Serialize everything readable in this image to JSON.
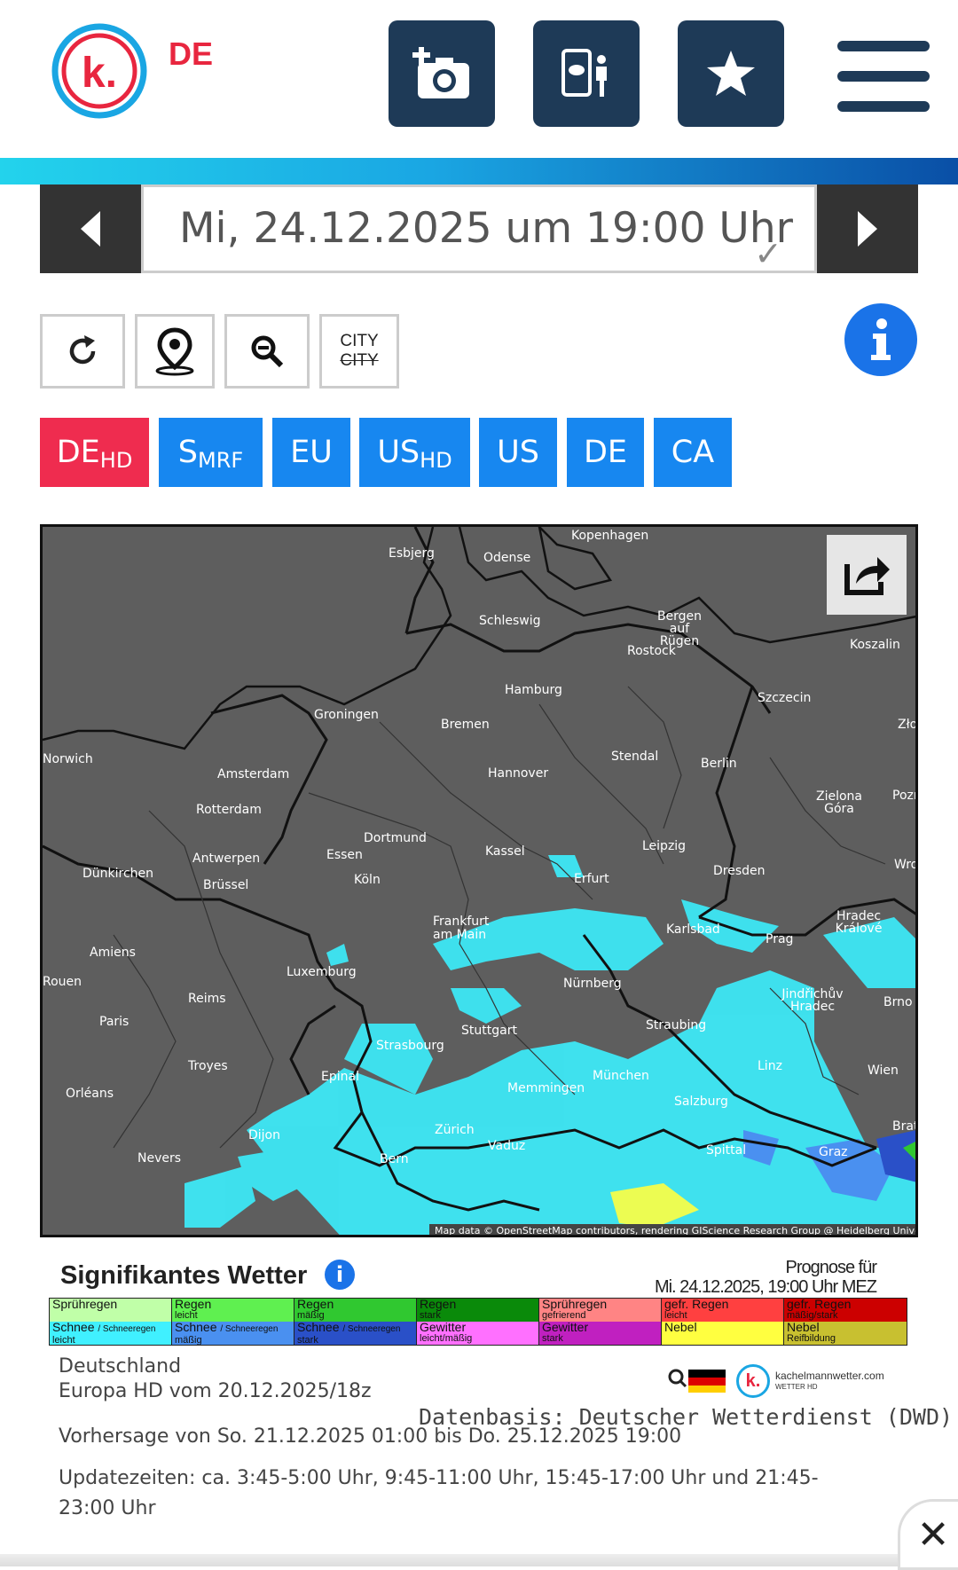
{
  "header": {
    "logo_letter": "k.",
    "region_label": "DE",
    "buttons": [
      {
        "name": "add-photo",
        "icon": "camera-plus-icon"
      },
      {
        "name": "weather-reporter",
        "icon": "phone-person-icon"
      },
      {
        "name": "favorites",
        "icon": "star-icon"
      }
    ],
    "menu_icon": "hamburger-icon"
  },
  "date_nav": {
    "selected": "Mi, 24.12.2025 um 19:00 Uhr",
    "check": "✓"
  },
  "tools": {
    "refresh_icon": "refresh-icon",
    "location_icon": "map-pin-icon",
    "zoom_icon": "zoom-out-icon",
    "city_on": "CITY",
    "city_off": "CITY"
  },
  "model_tabs": [
    {
      "main": "DE",
      "sub": "HD",
      "active": true
    },
    {
      "main": "S",
      "sub": "MRF",
      "active": false
    },
    {
      "main": "EU",
      "sub": "",
      "active": false
    },
    {
      "main": "US",
      "sub": "HD",
      "active": false
    },
    {
      "main": "US",
      "sub": "",
      "active": false
    },
    {
      "main": "DE",
      "sub": "",
      "active": false
    },
    {
      "main": "CA",
      "sub": "",
      "active": false
    }
  ],
  "map": {
    "attribution": "Map data © OpenStreetMap contributors, rendering GIScience Research Group @ Heidelberg University",
    "cities": [
      "Kopenhagen",
      "Esbjerg",
      "Odense",
      "Schleswig",
      "Bergen auf Rügen",
      "Koszalin",
      "Rostock",
      "Hamburg",
      "Szczecin",
      "Groningen",
      "Bremen",
      "Stendal",
      "Berlin",
      "Amsterdam",
      "Hannover",
      "Rotterdam",
      "Zielona Góra",
      "Dortmund",
      "Essen",
      "Kassel",
      "Leipzig",
      "Antwerpen",
      "Köln",
      "Erfurt",
      "Dresden",
      "Dünkirchen",
      "Brüssel",
      "Frankfurt am Main",
      "Karlsbad",
      "Prag",
      "Hradec Králové",
      "Amiens",
      "Luxemburg",
      "Nürnberg",
      "Reims",
      "Jindřichův Hradec",
      "Paris",
      "Stuttgart",
      "Straubing",
      "Strasbourg",
      "Brno",
      "Troyes",
      "Epinal",
      "Memmingen",
      "München",
      "Linz",
      "Wien",
      "Orléans",
      "Salzburg",
      "Dijon",
      "Zürich",
      "Vaduz",
      "Nevers",
      "Bern",
      "Spittal",
      "Graz",
      "Norwich",
      "Zło",
      "Pozn",
      "Wro",
      "Brat",
      "Rouen"
    ]
  },
  "legend": {
    "title": "Signifikantes Wetter",
    "forecast_for_label": "Prognose für",
    "forecast_for_value": "Mi. 24.12.2025, 19:00 Uhr MEZ",
    "row1": [
      {
        "label": "Sprühregen",
        "sub": "",
        "color": "#c0ffa8"
      },
      {
        "label": "Regen",
        "sub": "leicht",
        "color": "#5ff050"
      },
      {
        "label": "Regen",
        "sub": "mäßig",
        "color": "#30c830"
      },
      {
        "label": "Regen",
        "sub": "stark",
        "color": "#0a8a0a"
      },
      {
        "label": "Sprühregen",
        "sub": "gefrierend",
        "color": "#ff8484"
      },
      {
        "label": "gefr. Regen",
        "sub": "leicht",
        "color": "#ff4040"
      },
      {
        "label": "gefr. Regen",
        "sub": "mäßig/stark",
        "color": "#cc0000"
      }
    ],
    "row2": [
      {
        "label": "Schnee",
        "extra": "/ Schneeregen",
        "sub": "leicht",
        "color": "#40f0ff"
      },
      {
        "label": "Schnee",
        "extra": "/ Schneeregen",
        "sub": "mäßig",
        "color": "#4a90f0"
      },
      {
        "label": "Schnee",
        "extra": "/ Schneeregen",
        "sub": "stark",
        "color": "#2a50c8"
      },
      {
        "label": "Gewitter",
        "extra": "",
        "sub": "leicht/mäßig",
        "color": "#ff70ff"
      },
      {
        "label": "Gewitter",
        "extra": "",
        "sub": "stark",
        "color": "#c020c0"
      },
      {
        "label": "Nebel",
        "extra": "",
        "sub": "",
        "color": "#ffff40"
      },
      {
        "label": "Nebel",
        "extra": "",
        "sub": "Reifbildung",
        "color": "#c8c030"
      }
    ],
    "brand_text": "kachelmannwetter.com",
    "brand_sub": "WETTER HD"
  },
  "info": {
    "region": "Deutschland",
    "model_run": "Europa HD vom 20.12.2025/18z",
    "data_source": "Datenbasis: Deutscher Wetterdienst (DWD)",
    "forecast_range": "Vorhersage von So. 21.12.2025 01:00 bis Do. 25.12.2025 19:00",
    "update_line1": "Updatezeiten: ca. 3:45-5:00 Uhr, 9:45-11:00 Uhr, 15:45-17:00 Uhr und 21:45-",
    "update_line2": "23:00 Uhr"
  },
  "close_label": "✕"
}
